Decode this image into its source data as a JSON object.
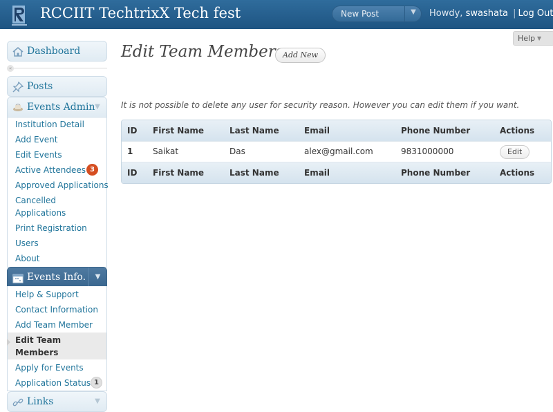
{
  "header": {
    "site_title": "RCCIIT TechtrixX Tech fest",
    "favorite_action": "New Post",
    "howdy": "Howdy,",
    "username": "swashata",
    "separator": "|",
    "logout": "Log Out"
  },
  "help_tab": {
    "label": "Help"
  },
  "sidebar": {
    "dashboard": "Dashboard",
    "posts": "Posts",
    "events_admin": {
      "label": "Events Admin",
      "items": [
        {
          "label": "Institution Detail"
        },
        {
          "label": "Add Event"
        },
        {
          "label": "Edit Events"
        },
        {
          "label": "Active Attendees",
          "badge": "3"
        },
        {
          "label": "Approved Applications"
        },
        {
          "label": "Cancelled"
        },
        {
          "label": "Applications"
        },
        {
          "label": "Print Registration"
        },
        {
          "label": "Users"
        },
        {
          "label": "About"
        }
      ]
    },
    "events_info": {
      "label": "Events Info.",
      "items": [
        {
          "label": "Help & Support"
        },
        {
          "label": "Contact Information"
        },
        {
          "label": "Add Team Member"
        },
        {
          "label": "Edit Team"
        },
        {
          "label": "Members"
        },
        {
          "label": "Apply for Events"
        },
        {
          "label": "Application Status",
          "badge": "1"
        }
      ]
    },
    "links": "Links"
  },
  "main": {
    "page_title": "Edit Team Members",
    "add_new": "Add New",
    "notice": "It is not possible to delete any user for security reason. However you can edit them if you want.",
    "table": {
      "columns": [
        "ID",
        "First Name",
        "Last Name",
        "Email",
        "Phone Number",
        "Actions"
      ],
      "rows": [
        {
          "id": "1",
          "first": "Saikat",
          "last": "Das",
          "email": "alex@gmail.com",
          "phone": "9831000000",
          "action": "Edit"
        }
      ]
    }
  },
  "colors": {
    "header_bg": "#2f6c9c",
    "link": "#21759b",
    "badge_red": "#d54e21",
    "active_menu": "#4f7aa1"
  }
}
